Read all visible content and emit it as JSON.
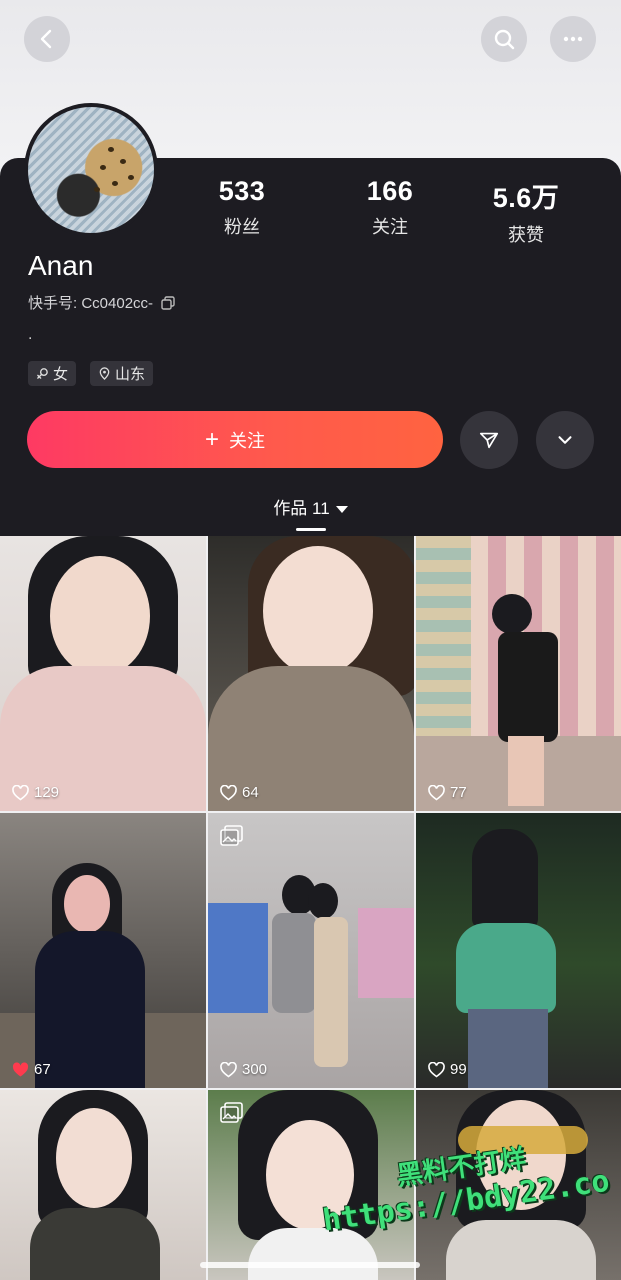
{
  "profile": {
    "name": "Anan",
    "uid_label": "快手号: Cc0402cc-",
    "bio": ".",
    "tags": [
      {
        "icon": "gender-female-icon",
        "label": "女"
      },
      {
        "icon": "location-pin-icon",
        "label": "山东"
      }
    ]
  },
  "stats": [
    {
      "value": "533",
      "label": "粉丝"
    },
    {
      "value": "166",
      "label": "关注"
    },
    {
      "value": "5.6万",
      "label": "获赞"
    }
  ],
  "actions": {
    "follow_label": "关注"
  },
  "works": {
    "tab_label": "作品 11"
  },
  "grid": [
    {
      "likes": "129",
      "liked": false,
      "multi": false
    },
    {
      "likes": "64",
      "liked": false,
      "multi": false
    },
    {
      "likes": "77",
      "liked": false,
      "multi": false
    },
    {
      "likes": "67",
      "liked": true,
      "multi": false
    },
    {
      "likes": "300",
      "liked": false,
      "multi": true
    },
    {
      "likes": "99",
      "liked": false,
      "multi": false
    },
    {
      "likes": "",
      "liked": false,
      "multi": false
    },
    {
      "likes": "",
      "liked": false,
      "multi": true
    },
    {
      "likes": "",
      "liked": false,
      "multi": false
    }
  ],
  "watermark": {
    "line1": "黑料不打烊",
    "line2": "https://bdy22.co"
  },
  "colors": {
    "accent_start": "#fe3a63",
    "accent_end": "#ff6340",
    "panel_bg": "#1d1c22",
    "liked_heart": "#ff3b4e"
  }
}
